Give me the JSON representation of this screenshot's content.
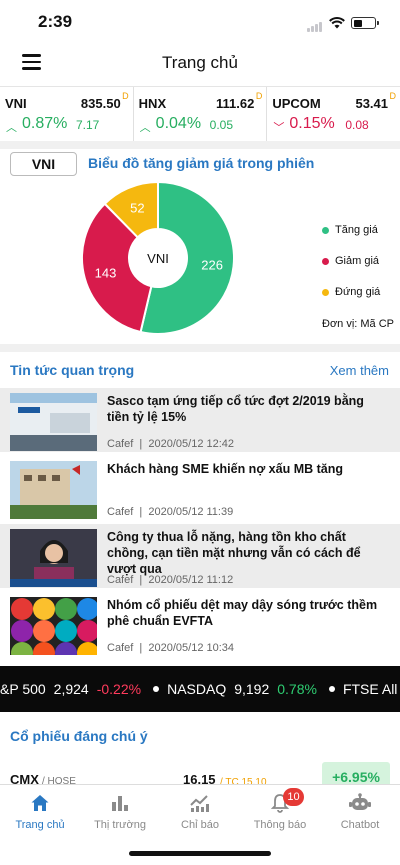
{
  "status": {
    "time": "2:39"
  },
  "header": {
    "title": "Trang chủ"
  },
  "indices": [
    {
      "name": "VNI",
      "value": "835.50",
      "flag": "D",
      "arrow": "^",
      "pct": "0.87%",
      "change": "7.17",
      "dir": "up"
    },
    {
      "name": "HNX",
      "value": "111.62",
      "flag": "D",
      "arrow": "^",
      "pct": "0.04%",
      "change": "0.05",
      "dir": "up"
    },
    {
      "name": "UPCOM",
      "value": "53.41",
      "flag": "D",
      "arrow": "v",
      "pct": "0.15%",
      "change": "0.08",
      "dir": "down"
    }
  ],
  "chart_section": {
    "tab_label": "VNI",
    "title": "Biểu đồ tăng giảm giá trong phiên",
    "center_label": "VNI",
    "unit_note": "Đơn vị: Mã CP"
  },
  "chart_data": {
    "type": "pie",
    "title": "Biểu đồ tăng giảm giá trong phiên",
    "categories": [
      "Tăng giá",
      "Giảm giá",
      "Đứng giá"
    ],
    "values": [
      226,
      143,
      52
    ],
    "colors": [
      "#2fc084",
      "#d81b4c",
      "#f5b80f"
    ]
  },
  "news": {
    "title": "Tin tức quan trọng",
    "see_more": "Xem thêm",
    "items": [
      {
        "title": "Sasco tạm ứng tiếp cổ tức đợt 2/2019 bằng tiền tỷ lệ 15%",
        "source": "Cafef",
        "time": "2020/05/12 12:42"
      },
      {
        "title": "Khách hàng SME khiến nợ xấu MB tăng",
        "source": "Cafef",
        "time": "2020/05/12 11:39"
      },
      {
        "title": "Công ty thua lỗ nặng, hàng tồn kho chất chồng, cạn tiền mặt nhưng vẫn có cách để vượt qua",
        "source": "Cafef",
        "time": "2020/05/12 11:12"
      },
      {
        "title": "Nhóm cổ phiếu dệt may dậy sóng trước thềm phê chuẩn EVFTA",
        "source": "Cafef",
        "time": "2020/05/12 10:34"
      }
    ]
  },
  "ticker": [
    {
      "name": "&P 500",
      "value": "2,924",
      "change": "-0.22%",
      "dir": "down"
    },
    {
      "name": "NASDAQ",
      "value": "9,192",
      "change": "0.78%",
      "dir": "up"
    },
    {
      "name": "FTSE All",
      "value": "",
      "change": "",
      "dir": ""
    }
  ],
  "stocks": {
    "title": "Cổ phiếu đáng chú ý",
    "items": [
      {
        "symbol": "CMX",
        "exchange": "/ HOSE",
        "price": "16.15",
        "ref": "/ TC 15.10",
        "change": "+6.95%"
      }
    ]
  },
  "tabbar": [
    {
      "label": "Trang chủ",
      "icon": "home-icon",
      "active": true
    },
    {
      "label": "Thị trường",
      "icon": "bar-chart-icon",
      "active": false
    },
    {
      "label": "Chỉ báo",
      "icon": "indicator-chart-icon",
      "active": false
    },
    {
      "label": "Thông báo",
      "icon": "bell-icon",
      "active": false,
      "badge": "10"
    },
    {
      "label": "Chatbot",
      "icon": "robot-icon",
      "active": false
    }
  ],
  "colors": {
    "accent": "#2a78c2",
    "up": "#27ae60",
    "down": "#d81b4c",
    "ref": "#f0a000"
  }
}
